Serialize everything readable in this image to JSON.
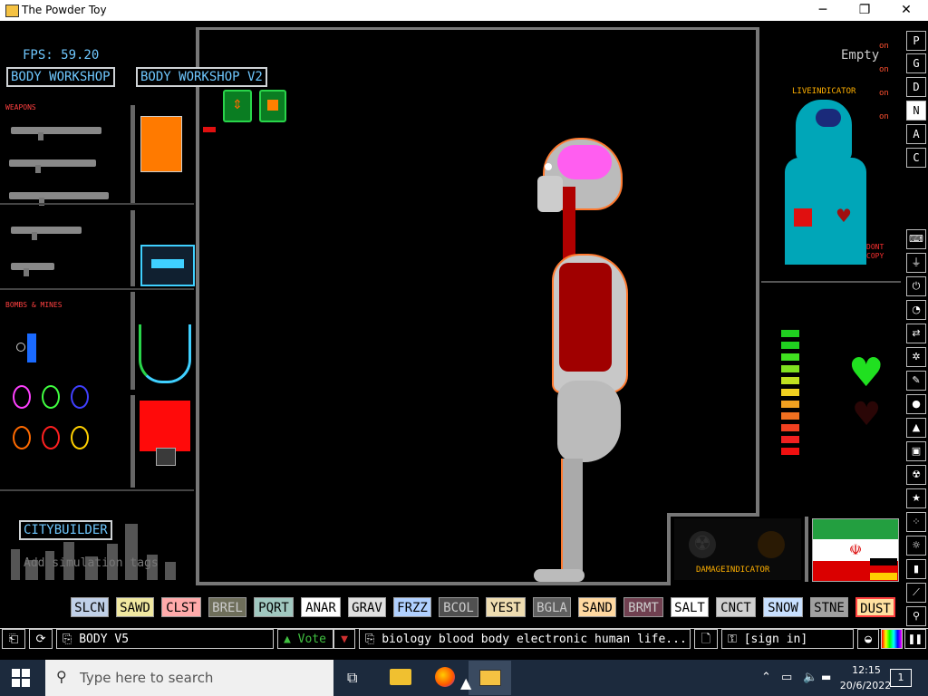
{
  "window": {
    "title": "The Powder Toy",
    "minimize": "─",
    "maximize": "❐",
    "close": "✕"
  },
  "hud": {
    "fps": "FPS: 59.20",
    "cursor_element": "Empty",
    "on_labels": [
      "on",
      "on",
      "on",
      "on"
    ]
  },
  "tabs": {
    "body_workshop": "BODY WORKSHOP",
    "body_workshop_v2": "BODY WORKSHOP V2"
  },
  "left_panel": {
    "weapons_label": "WEAPONS",
    "bombs_label": "BOMBS & MINES",
    "citybuilder": "CITYBUILDER",
    "sim_tags_placeholder": "Add simulation tags"
  },
  "right_panel": {
    "live_indicator": "LIVEINDICATOR",
    "dont_copy": "DONT COPY",
    "damage_indicator": "DAMAGEINDICATOR",
    "menu_buttons": [
      "P",
      "G",
      "D",
      "N",
      "A",
      "C"
    ]
  },
  "elements": [
    "SLCN",
    "SAWD",
    "CLST",
    "BREL",
    "PQRT",
    "ANAR",
    "GRAV",
    "FRZZ",
    "BCOL",
    "YEST",
    "BGLA",
    "SAND",
    "BRMT",
    "SALT",
    "CNCT",
    "SNOW",
    "STNE",
    "DUST"
  ],
  "element_colors": [
    "#c0d0e8",
    "#f0e8a0",
    "#ffaaaa",
    "#6e6e5a",
    "#a0c8c0",
    "#ffffff",
    "#e0e0e0",
    "#b0d0ff",
    "#505050",
    "#eedcb0",
    "#606060",
    "#ffd8a0",
    "#704050",
    "#ffffff",
    "#d0d0d0",
    "#c8e0ff",
    "#a0a0a0",
    "#ffe0a0"
  ],
  "bottom_bar": {
    "save_name": "BODY V5",
    "vote": "Vote",
    "tags": "biology blood body electronic human life...",
    "sign_in": "[sign in]"
  },
  "taskbar": {
    "search_placeholder": "Type here to search",
    "time": "12:15",
    "date": "20/6/2022",
    "notifications": "1"
  }
}
